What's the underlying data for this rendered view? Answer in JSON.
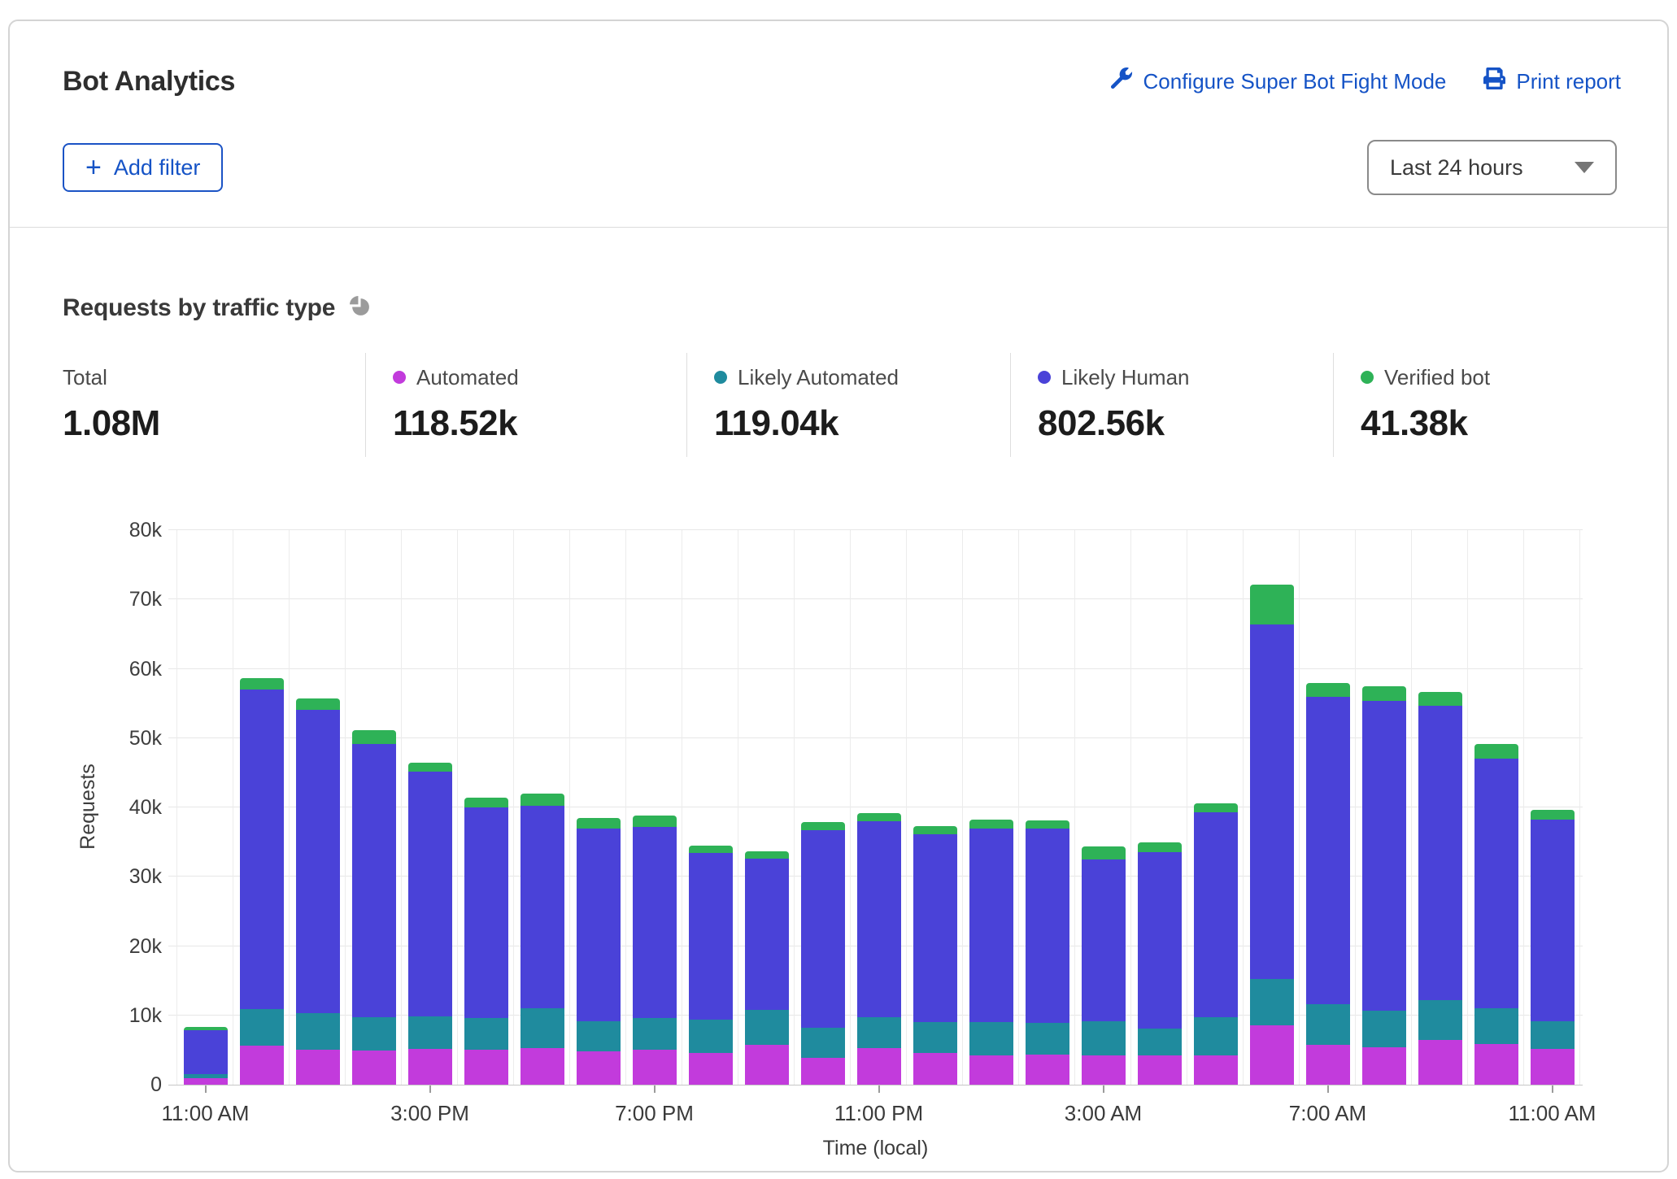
{
  "header": {
    "title": "Bot Analytics",
    "configure_link": "Configure Super Bot Fight Mode",
    "print_link": "Print report",
    "add_filter_label": "Add filter",
    "plus_glyph": "+",
    "time_range_selected": "Last 24 hours"
  },
  "section": {
    "title": "Requests by traffic type"
  },
  "stats": [
    {
      "label": "Total",
      "value": "1.08M",
      "color": ""
    },
    {
      "label": "Automated",
      "value": "118.52k",
      "color": "#C23BDC"
    },
    {
      "label": "Likely Automated",
      "value": "119.04k",
      "color": "#1F8B9E"
    },
    {
      "label": "Likely Human",
      "value": "802.56k",
      "color": "#4A42D8"
    },
    {
      "label": "Verified bot",
      "value": "41.38k",
      "color": "#2EB257"
    }
  ],
  "colors": {
    "link_blue": "#1553C6",
    "automated": "#C23BDC",
    "likely_automated": "#1F8B9E",
    "likely_human": "#4A42D8",
    "verified_bot": "#2EB257",
    "grid": "#e7e7e7",
    "axis": "#c6c6c6"
  },
  "chart_data": {
    "type": "bar",
    "stacked": true,
    "title": "Requests by traffic type",
    "xlabel": "Time (local)",
    "ylabel": "Requests",
    "ylim": [
      0,
      80000
    ],
    "yticks": [
      "0",
      "10k",
      "20k",
      "30k",
      "40k",
      "50k",
      "60k",
      "70k",
      "80k"
    ],
    "grid": true,
    "legend_position": "top (stats row)",
    "categories": [
      "11:00 AM",
      "12:00 PM",
      "1:00 PM",
      "2:00 PM",
      "3:00 PM",
      "4:00 PM",
      "5:00 PM",
      "6:00 PM",
      "7:00 PM",
      "8:00 PM",
      "9:00 PM",
      "10:00 PM",
      "11:00 PM",
      "12:00 AM",
      "1:00 AM",
      "2:00 AM",
      "3:00 AM",
      "4:00 AM",
      "5:00 AM",
      "6:00 AM",
      "7:00 AM",
      "8:00 AM",
      "9:00 AM",
      "10:00 AM",
      "11:00 AM"
    ],
    "tick_indices": [
      0,
      4,
      8,
      12,
      16,
      20,
      24
    ],
    "tick_labels": [
      "11:00 AM",
      "3:00 PM",
      "7:00 PM",
      "11:00 PM",
      "3:00 AM",
      "7:00 AM",
      "11:00 AM"
    ],
    "series": [
      {
        "name": "Automated",
        "color": "#C23BDC",
        "values": [
          900,
          5600,
          5000,
          4900,
          5200,
          5000,
          5300,
          4800,
          5000,
          4600,
          5800,
          3900,
          5300,
          4600,
          4200,
          4300,
          4200,
          4200,
          4200,
          8600,
          5800,
          5400,
          6500,
          5900,
          5200
        ]
      },
      {
        "name": "Likely Automated",
        "color": "#1F8B9E",
        "values": [
          600,
          5300,
          5300,
          4800,
          4700,
          4600,
          5700,
          4300,
          4600,
          4800,
          5000,
          4300,
          4400,
          4400,
          4800,
          4600,
          5000,
          3900,
          5500,
          6700,
          5800,
          5300,
          5700,
          5100,
          3900
        ]
      },
      {
        "name": "Likely Human",
        "color": "#4A42D8",
        "values": [
          6400,
          46100,
          43800,
          39500,
          35300,
          30400,
          29200,
          27800,
          27600,
          24000,
          21800,
          28500,
          28300,
          27100,
          28000,
          28000,
          23300,
          25500,
          29600,
          51100,
          44400,
          44700,
          42500,
          36000,
          29100
        ]
      },
      {
        "name": "Verified bot",
        "color": "#2EB257",
        "values": [
          400,
          1600,
          1600,
          2000,
          1300,
          1400,
          1800,
          1600,
          1600,
          1100,
          1100,
          1200,
          1200,
          1200,
          1200,
          1200,
          1900,
          1400,
          1300,
          5800,
          1900,
          2100,
          2000,
          2100,
          1500
        ]
      }
    ]
  }
}
